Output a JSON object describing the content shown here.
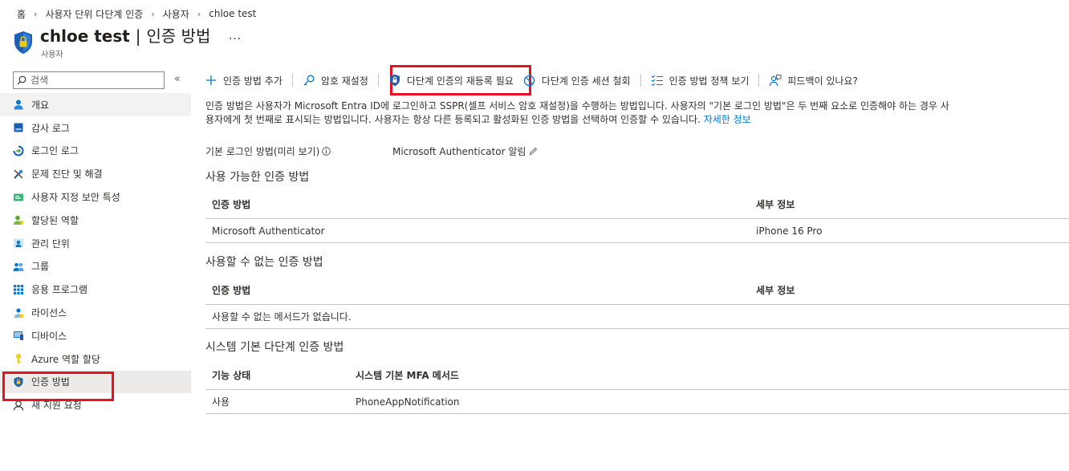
{
  "breadcrumb": [
    "홈",
    "사용자 단위 다단계 인증",
    "사용자",
    "chloe test"
  ],
  "header": {
    "title_name": "chloe test",
    "title_separator": "|",
    "title_page": "인증 방법",
    "more": "…",
    "subtitle": "사용자"
  },
  "sidebar": {
    "search_placeholder": "검색",
    "collapse": "«",
    "items": [
      {
        "label": "개요",
        "icon": "user-icon"
      },
      {
        "label": "감사 로그",
        "icon": "log-icon"
      },
      {
        "label": "로그인 로그",
        "icon": "signin-log-icon"
      },
      {
        "label": "문제 진단 및 해결",
        "icon": "wrench-icon"
      },
      {
        "label": "사용자 지정 보안 특성",
        "icon": "attributes-icon"
      },
      {
        "label": "할당된 역할",
        "icon": "role-icon"
      },
      {
        "label": "관리 단위",
        "icon": "admin-unit-icon"
      },
      {
        "label": "그룹",
        "icon": "group-icon"
      },
      {
        "label": "응용 프로그램",
        "icon": "apps-grid-icon"
      },
      {
        "label": "라이선스",
        "icon": "license-icon"
      },
      {
        "label": "디바이스",
        "icon": "device-icon"
      },
      {
        "label": "Azure 역할 할당",
        "icon": "key-icon"
      },
      {
        "label": "인증 방법",
        "icon": "shield-icon"
      },
      {
        "label": "새 지원 요청",
        "icon": "support-icon"
      }
    ]
  },
  "toolbar": {
    "add": "인증 방법 추가",
    "reset_password": "암호 재설정",
    "require_reregister": "다단계 인증의 재등록 필요",
    "revoke_sessions": "다단계 인증 세션 철회",
    "view_policy": "인증 방법 정책 보기",
    "feedback": "피드백이 있나요?"
  },
  "description": {
    "text": "인증 방법은 사용자가 Microsoft Entra ID에 로그인하고 SSPR(셀프 서비스 암호 재설정)을 수행하는 방법입니다. 사용자의 \"기본 로그인 방법\"은 두 번째 요소로 인증해야 하는 경우 사용자에게 첫 번째로 표시되는 방법입니다. 사용자는 항상 다른 등록되고 활성화된 인증 방법을 선택하여 인증할 수 있습니다.",
    "link": "자세한 정보"
  },
  "default_method": {
    "label": "기본 로그인 방법(미리 보기)",
    "value": "Microsoft Authenticator 알림"
  },
  "usable": {
    "title": "사용 가능한 인증 방법",
    "col_method": "인증 방법",
    "col_details": "세부 정보",
    "rows": [
      {
        "method": "Microsoft Authenticator",
        "details": "iPhone 16 Pro"
      }
    ]
  },
  "unusable": {
    "title": "사용할 수 없는 인증 방법",
    "col_method": "인증 방법",
    "col_details": "세부 정보",
    "empty": "사용할 수 없는 메서드가 없습니다."
  },
  "system_mfa": {
    "title": "시스템 기본 다단계 인증 방법",
    "col_status": "기능 상태",
    "col_method": "시스템 기본 MFA 메서드",
    "rows": [
      {
        "status": "사용",
        "method": "PhoneAppNotification"
      }
    ]
  },
  "colors": {
    "accent": "#0078d4",
    "highlight": "#e81123"
  }
}
